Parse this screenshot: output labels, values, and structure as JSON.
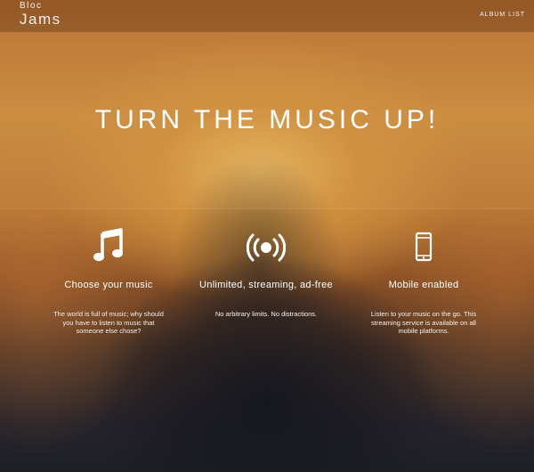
{
  "navbar": {
    "logo_top": "Bloc",
    "logo_bottom": "Jams",
    "album_list_link": "ALBUM LIST"
  },
  "hero": {
    "title": "TURN THE MUSIC UP!"
  },
  "features": [
    {
      "icon": "music-note-icon",
      "title": "Choose your music",
      "description": "The world is full of music; why should you have to listen to music that someone else chose?"
    },
    {
      "icon": "broadcast-icon",
      "title": "Unlimited, streaming, ad-free",
      "description": "No arbitrary limits. No distractions."
    },
    {
      "icon": "mobile-phone-icon",
      "title": "Mobile enabled",
      "description": "Listen to your music on the go. This streaming service is available on all mobile platforms."
    }
  ],
  "colors": {
    "text": "#ffffff",
    "background_top": "#b86c2f",
    "background_glow": "#e2b25e",
    "background_bottom": "#1d1f27"
  }
}
